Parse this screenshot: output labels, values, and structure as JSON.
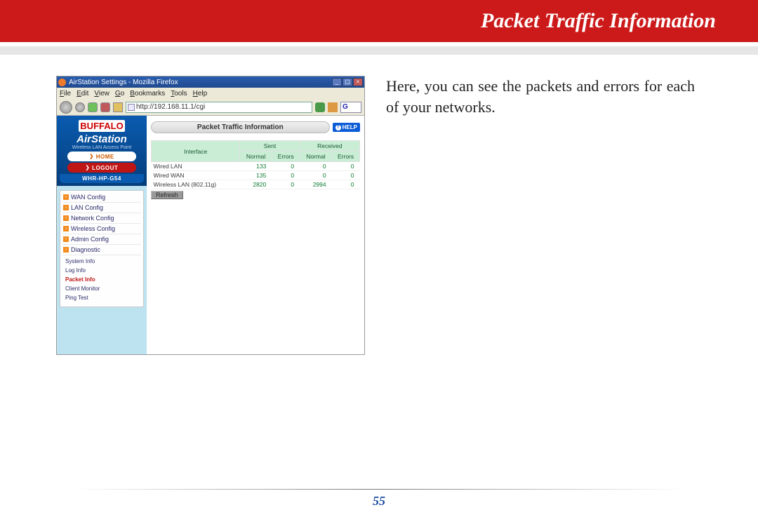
{
  "header": {
    "title": "Packet Traffic Information"
  },
  "description": "Here, you can see the packets and errors for each of your networks.",
  "page_number": "55",
  "browser": {
    "title": "AirStation Settings - Mozilla Firefox",
    "menu": [
      "File",
      "Edit",
      "View",
      "Go",
      "Bookmarks",
      "Tools",
      "Help"
    ],
    "url": "http://192.168.11.1/cgi",
    "search_hint": "G"
  },
  "sidebar": {
    "brand": "BUFFALO",
    "product": "AirStation",
    "subtitle": "Wireless LAN Access Point",
    "home_label": "HOME",
    "logout_label": "LOGOUT",
    "model": "WHR-HP-G54",
    "config_items": [
      "WAN Config",
      "LAN Config",
      "Network Config",
      "Wireless Config",
      "Admin Config",
      "Diagnostic"
    ],
    "sub_items": [
      {
        "label": "System Info",
        "active": false
      },
      {
        "label": "Log Info",
        "active": false
      },
      {
        "label": "Packet Info",
        "active": true
      },
      {
        "label": "Client Monitor",
        "active": false
      },
      {
        "label": "Ping Test",
        "active": false
      }
    ]
  },
  "panel": {
    "title": "Packet Traffic Information",
    "help_label": "HELP",
    "refresh_label": "Refresh",
    "columns": {
      "interface": "Interface",
      "sent": "Sent",
      "received": "Received",
      "normal": "Normal",
      "errors": "Errors"
    },
    "rows": [
      {
        "iface": "Wired LAN",
        "sent_normal": "133",
        "sent_errors": "0",
        "recv_normal": "0",
        "recv_errors": "0"
      },
      {
        "iface": "Wired WAN",
        "sent_normal": "135",
        "sent_errors": "0",
        "recv_normal": "0",
        "recv_errors": "0"
      },
      {
        "iface": "Wireless LAN (802.11g)",
        "sent_normal": "2820",
        "sent_errors": "0",
        "recv_normal": "2994",
        "recv_errors": "0"
      }
    ]
  }
}
